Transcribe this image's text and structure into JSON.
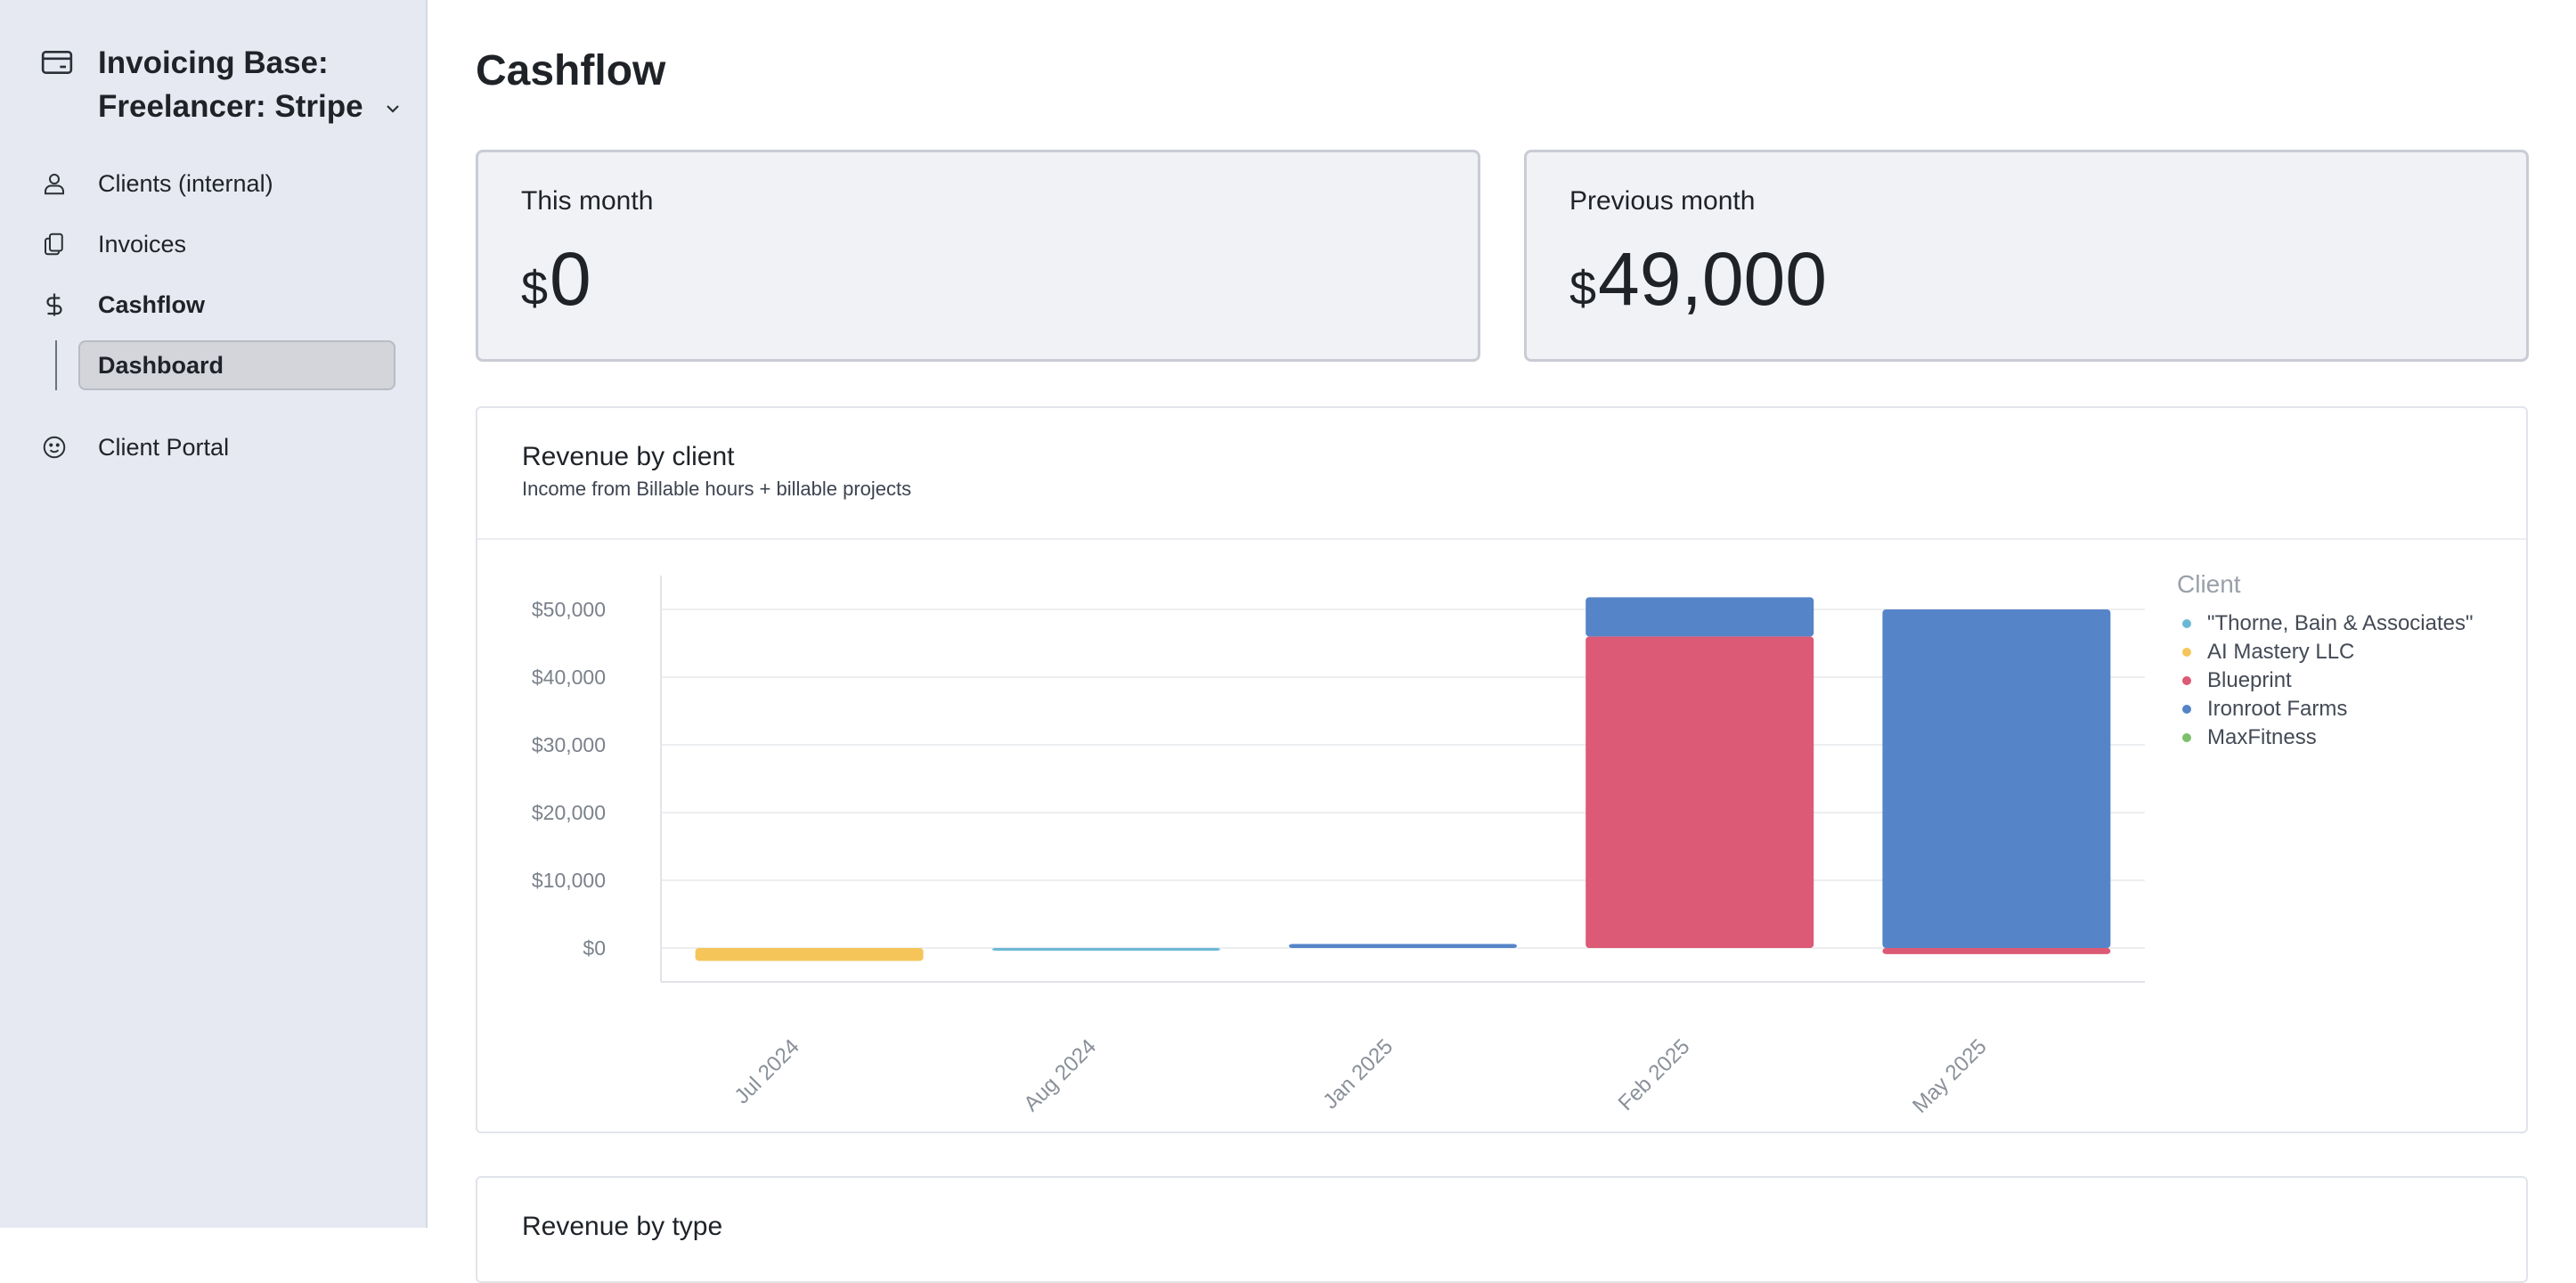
{
  "sidebar": {
    "workspace_line1": "Invoicing Base:",
    "workspace_line2": "Freelancer: Stripe",
    "items": [
      {
        "label": "Clients (internal)",
        "icon": "person-icon"
      },
      {
        "label": "Invoices",
        "icon": "documents-icon"
      },
      {
        "label": "Cashflow",
        "icon": "dollar-icon"
      },
      {
        "label": "Client Portal",
        "icon": "smiley-icon"
      }
    ],
    "subitem": "Dashboard"
  },
  "page": {
    "title": "Cashflow"
  },
  "stats": {
    "this_month": {
      "label": "This month",
      "currency": "$",
      "value": "0"
    },
    "previous_month": {
      "label": "Previous month",
      "currency": "$",
      "value": "49,000"
    }
  },
  "revenue_by_client": {
    "title": "Revenue by client",
    "subtitle": "Income from Billable hours + billable projects"
  },
  "revenue_by_type": {
    "title": "Revenue by type"
  },
  "colors": {
    "thorne": "#6bb8d6",
    "ai_mastery": "#f6c55a",
    "blueprint": "#dc5a75",
    "ironroot": "#5584c8",
    "maxfitness": "#7dbf6a"
  },
  "chart_data": {
    "type": "bar",
    "stacked": true,
    "categories": [
      "Jul 2024",
      "Aug 2024",
      "Jan 2025",
      "Feb 2025",
      "May 2025"
    ],
    "series": [
      {
        "name": "\"Thorne, Bain & Associates\"",
        "color": "#6bb8d6",
        "values": [
          0,
          -300,
          0,
          0,
          0
        ]
      },
      {
        "name": "AI Mastery LLC",
        "color": "#f6c55a",
        "values": [
          -1900,
          0,
          0,
          0,
          0
        ]
      },
      {
        "name": "Blueprint",
        "color": "#dc5a75",
        "values": [
          0,
          0,
          0,
          46000,
          -900
        ]
      },
      {
        "name": "Ironroot Farms",
        "color": "#5584c8",
        "values": [
          0,
          0,
          600,
          5800,
          50000
        ]
      },
      {
        "name": "MaxFitness",
        "color": "#7dbf6a",
        "values": [
          0,
          0,
          0,
          0,
          0
        ]
      }
    ],
    "yticks": [
      "$0",
      "$10,000",
      "$20,000",
      "$30,000",
      "$40,000",
      "$50,000"
    ],
    "ylim": [
      -5000,
      55000
    ],
    "legend_title": "Client",
    "legend_position": "right",
    "grid": true
  }
}
